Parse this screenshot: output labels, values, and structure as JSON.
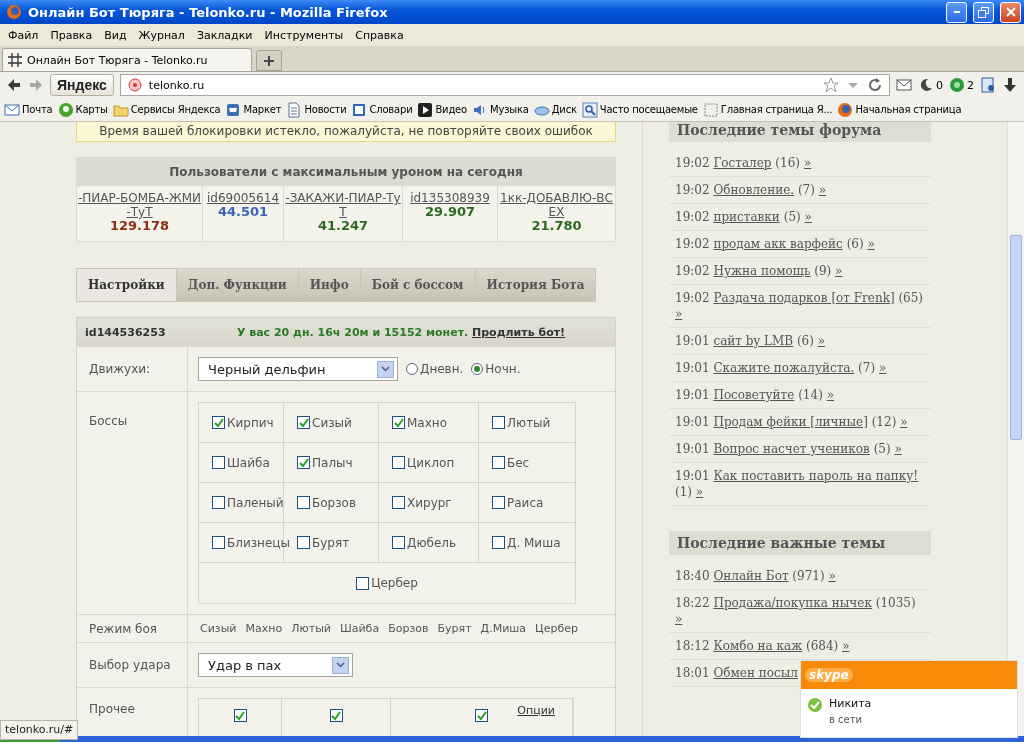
{
  "window": {
    "title": "Онлайн Бот Тюряга - Telonko.ru - Mozilla Firefox"
  },
  "menu": [
    "Файл",
    "Правка",
    "Вид",
    "Журнал",
    "Закладки",
    "Инструменты",
    "Справка"
  ],
  "tabs": [
    {
      "label": "Онлайн Бот Тюряга - Telonko.ru",
      "selected": true
    }
  ],
  "nav": {
    "search_button": "Яндекс",
    "url": "telonko.ru",
    "counters": [
      "0",
      "2"
    ]
  },
  "bookmarks": [
    "Почта",
    "Карты",
    "Сервисы Яндекса",
    "Маркет",
    "Новости",
    "Словари",
    "Видео",
    "Музыка",
    "Диск",
    "Часто посещаемые",
    "Главная страница Я...",
    "Начальная страница"
  ],
  "notice": "Время вашей блокировки истекло, пожалуйста, не повторяйте своих ошибок",
  "top_users": {
    "title": "Пользователи с максимальным уроном на сегодня",
    "users": [
      {
        "name": "-ПИАР-БОМБА-ЖМИ-ТуТ",
        "value": "129.178",
        "color": "#8b2e12"
      },
      {
        "name": "id69005614",
        "value": "44.501",
        "color": "#3f63b8"
      },
      {
        "name": "-ЗАКАЖИ-ПИАР-ТуТ",
        "value": "41.247",
        "color": "#2a6a22"
      },
      {
        "name": "id135308939",
        "value": "29.907",
        "color": "#2a6a22"
      },
      {
        "name": "1кк-ДОБАВЛЮ-ВСЕХ",
        "value": "21.780",
        "color": "#2a6a22"
      }
    ]
  },
  "section_tabs": [
    {
      "label": "Настройки",
      "selected": true
    },
    {
      "label": "Доп. Функции",
      "selected": false
    },
    {
      "label": "Инфо",
      "selected": false
    },
    {
      "label": "Бой с боссом",
      "selected": false
    },
    {
      "label": "История Бота",
      "selected": false
    }
  ],
  "panel": {
    "user_id": "id144536253",
    "balance": "У вас 20 дн. 16ч 20м и 15152 монет.",
    "extend_link": "Продлить бот!"
  },
  "movement": {
    "label": "Движухи:",
    "value": "Черный дельфин",
    "options": [
      {
        "label": "Дневн.",
        "selected": false
      },
      {
        "label": "Ночн.",
        "selected": true
      }
    ]
  },
  "bosses": {
    "label": "Боссы",
    "items": [
      {
        "label": "Кирпич",
        "checked": true
      },
      {
        "label": "Сизый",
        "checked": true
      },
      {
        "label": "Махно",
        "checked": true
      },
      {
        "label": "Лютый",
        "checked": false
      },
      {
        "label": "Шайба",
        "checked": false
      },
      {
        "label": "Палыч",
        "checked": true
      },
      {
        "label": "Циклоп",
        "checked": false
      },
      {
        "label": "Бес",
        "checked": false
      },
      {
        "label": "Паленый",
        "checked": false
      },
      {
        "label": "Борзов",
        "checked": false
      },
      {
        "label": "Хирург",
        "checked": false
      },
      {
        "label": "Раиса",
        "checked": false
      },
      {
        "label": "Близнецы",
        "checked": false
      },
      {
        "label": "Бурят",
        "checked": false
      },
      {
        "label": "Дюбель",
        "checked": false
      },
      {
        "label": "Д. Миша",
        "checked": false
      },
      {
        "label": "Цербер",
        "checked": false
      }
    ]
  },
  "fight_mode": {
    "label": "Режим боя",
    "items": [
      "Сизый",
      "Махно",
      "Лютый",
      "Шайба",
      "Борзов",
      "Бурят",
      "Д.Миша",
      "Цербер"
    ]
  },
  "strike": {
    "label": "Выбор удара",
    "value": "Удар в пах"
  },
  "other": {
    "label": "Прочее",
    "checks": [
      {
        "checked": true
      },
      {
        "checked": true
      },
      {
        "checked": true
      }
    ],
    "link": "Опции"
  },
  "forum_latest": {
    "title": "Последние темы форума",
    "topics": [
      {
        "time": "19:02",
        "title": "Госталер",
        "count": "(16)",
        "more": "»"
      },
      {
        "time": "19:02",
        "title": "Обновление.",
        "count": "(7)",
        "more": "»"
      },
      {
        "time": "19:02",
        "title": "приставки",
        "count": "(5)",
        "more": "»"
      },
      {
        "time": "19:02",
        "title": "продам акк варфейс",
        "count": "(6)",
        "more": "»"
      },
      {
        "time": "19:02",
        "title": "Нужна помощь",
        "count": "(9)",
        "more": "»"
      },
      {
        "time": "19:02",
        "title": "Раздача подарков [от Frenk]",
        "count": "(65)",
        "more": "»"
      },
      {
        "time": "19:01",
        "title": "сайт by LMB",
        "count": "(6)",
        "more": "»"
      },
      {
        "time": "19:01",
        "title": "Скажите пожалуйста.",
        "count": "(7)",
        "more": "»"
      },
      {
        "time": "19:01",
        "title": "Посоветуйте",
        "count": "(14)",
        "more": "»"
      },
      {
        "time": "19:01",
        "title": "Продам фейки [личные]",
        "count": "(12)",
        "more": "»"
      },
      {
        "time": "19:01",
        "title": "Вопрос насчет учеников",
        "count": "(5)",
        "more": "»"
      },
      {
        "time": "19:01",
        "title": "Как поставить пароль на папку!",
        "count": "(1)",
        "more": "»"
      }
    ]
  },
  "forum_important": {
    "title": "Последние важные темы",
    "topics": [
      {
        "time": "18:40",
        "title": "Онлайн Бот",
        "count": "(971)",
        "more": "»"
      },
      {
        "time": "18:22",
        "title": "Продажа/покупка нычек",
        "count": "(1035)",
        "more": "»"
      },
      {
        "time": "18:12",
        "title": "Комбо на каж",
        "count": "(684)",
        "more": "»"
      },
      {
        "time": "18:01",
        "title": "Обмен посыл"
      }
    ]
  },
  "status_url": "telonko.ru/#",
  "skype": {
    "logo": "skype",
    "contact": "Никита",
    "status": "в сети"
  }
}
